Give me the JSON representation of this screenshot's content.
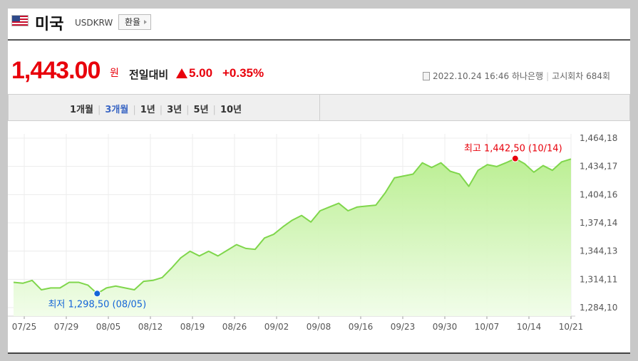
{
  "header": {
    "country": "미국",
    "code": "USDKRW",
    "fx_button": "환율"
  },
  "quote": {
    "price": "1,443.00",
    "unit": "원",
    "change_label": "전일대비",
    "change": "5.00",
    "change_pct": "+0.35%",
    "datetime": "2022.10.24 16:46",
    "bank": "하나은행",
    "notice": "고시회차 684회"
  },
  "periods": [
    "1개월",
    "3개월",
    "1년",
    "3년",
    "5년",
    "10년"
  ],
  "active_period": "3개월",
  "colors": {
    "up": "#e8000b",
    "line": "#7fd64b",
    "low_marker": "#1565d8",
    "high_marker": "#e8000b",
    "active_tab": "#3a66c4"
  },
  "chart_data": {
    "type": "area",
    "y_ticks": [
      "1,464,18",
      "1,434,17",
      "1,404,16",
      "1,374,14",
      "1,344,13",
      "1,314,11",
      "1,284,10"
    ],
    "y_tick_values": [
      1464.18,
      1434.17,
      1404.16,
      1374.14,
      1344.13,
      1314.11,
      1284.1
    ],
    "ylim": [
      1284.1,
      1464.18
    ],
    "x_ticks": [
      "07/25",
      "07/29",
      "08/05",
      "08/12",
      "08/19",
      "08/26",
      "09/02",
      "09/08",
      "09/16",
      "09/23",
      "09/30",
      "10/07",
      "10/14",
      "10/21"
    ],
    "values": [
      1311,
      1310,
      1313,
      1303,
      1305,
      1305,
      1311,
      1311,
      1308,
      1299,
      1305,
      1307,
      1305,
      1303,
      1312,
      1313,
      1316,
      1326,
      1337,
      1344,
      1339,
      1344,
      1339,
      1345,
      1351,
      1347,
      1346,
      1358,
      1362,
      1370,
      1377,
      1382,
      1375,
      1387,
      1391,
      1395,
      1387,
      1391,
      1392,
      1393,
      1406,
      1422,
      1424,
      1426,
      1438,
      1433,
      1438,
      1429,
      1426,
      1413,
      1430,
      1436,
      1434,
      1438,
      1442.5,
      1437,
      1428,
      1435,
      1430,
      1439,
      1442
    ],
    "low": {
      "label": "최저 1,298,50 (08/05)",
      "index": 9
    },
    "high": {
      "label": "최고 1,442,50 (10/14)",
      "index": 54
    },
    "grid": true
  }
}
